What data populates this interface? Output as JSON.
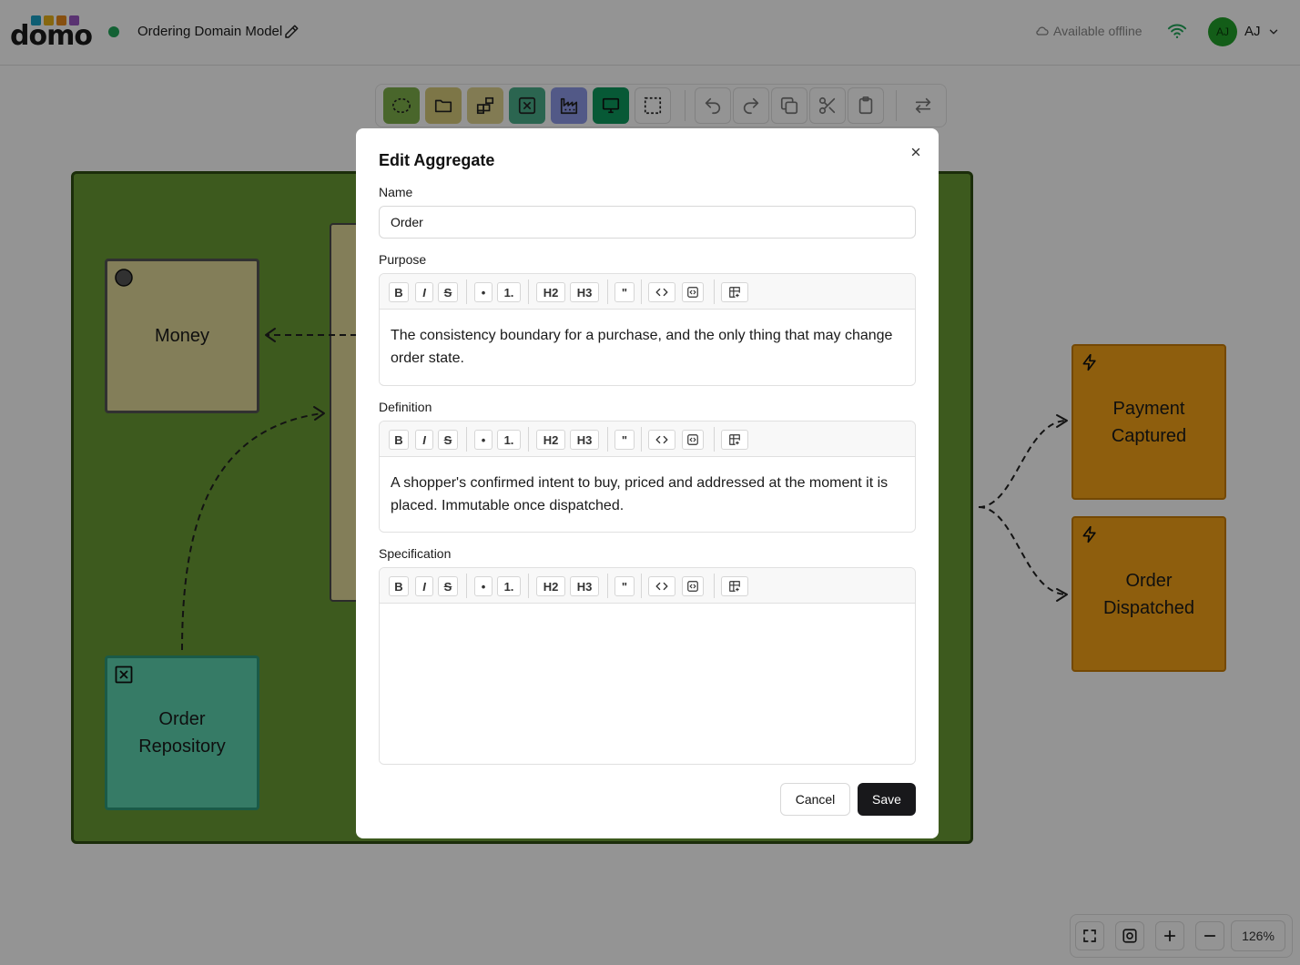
{
  "header": {
    "logo_text": "domo",
    "logo_colors": [
      "#1aa3c6",
      "#e7b21a",
      "#e88a1c",
      "#9b59c5"
    ],
    "document_title": "Ordering Domain Model",
    "status_color": "#22a85a",
    "offline_label": "Available offline",
    "user": {
      "avatar_initials": "AJ",
      "name_initials": "AJ",
      "avatar_color": "#22a02a"
    }
  },
  "toolbar": {
    "tools": [
      {
        "name": "bounded-context-tool",
        "icon": "dashed-ellipse-icon",
        "color": "#7fb04a"
      },
      {
        "name": "module-tool",
        "icon": "folder-icon",
        "color": "#d8cc7a"
      },
      {
        "name": "aggregate-tool",
        "icon": "blocks-icon",
        "color": "#e0d490"
      },
      {
        "name": "repository-tool",
        "icon": "square-x-icon",
        "color": "#4aae8a"
      },
      {
        "name": "factory-tool",
        "icon": "factory-icon",
        "color": "#8e9ae8"
      },
      {
        "name": "service-tool",
        "icon": "monitor-icon",
        "color": "#0d9a5e"
      },
      {
        "name": "selection-tool",
        "icon": "dashed-square-icon",
        "color": "#ffffff"
      }
    ],
    "actions": [
      "undo-icon",
      "redo-icon",
      "copy-icon",
      "cut-icon",
      "paste-icon",
      "swap-icon"
    ]
  },
  "canvas": {
    "nodes": [
      {
        "name": "money-node",
        "label": "Money",
        "icon": "circle-icon"
      },
      {
        "name": "order-repository-node",
        "label": "Order\nRepository",
        "icon": "square-x-icon"
      },
      {
        "name": "payment-captured-node",
        "label": "Payment\nCaptured",
        "icon": "lightning-icon"
      },
      {
        "name": "order-dispatched-node",
        "label": "Order\nDispatched",
        "icon": "lightning-icon"
      }
    ]
  },
  "zoom": {
    "level": "126%",
    "buttons": [
      "fit-screen-icon",
      "focus-icon",
      "plus-icon",
      "minus-icon"
    ]
  },
  "modal": {
    "title": "Edit Aggregate",
    "name_label": "Name",
    "name_value": "Order",
    "editor_buttons": [
      "B",
      "I",
      "S",
      "•",
      "1.",
      "H2",
      "H3",
      "\""
    ],
    "editors": [
      {
        "label": "Purpose",
        "content": "The consistency boundary for a purchase, and the only thing that may change order state."
      },
      {
        "label": "Definition",
        "content": "A shopper's confirmed intent to buy, priced and addressed at the moment it is placed. Immutable once dispatched."
      },
      {
        "label": "Specification",
        "content": ""
      }
    ],
    "cancel_label": "Cancel",
    "save_label": "Save"
  }
}
